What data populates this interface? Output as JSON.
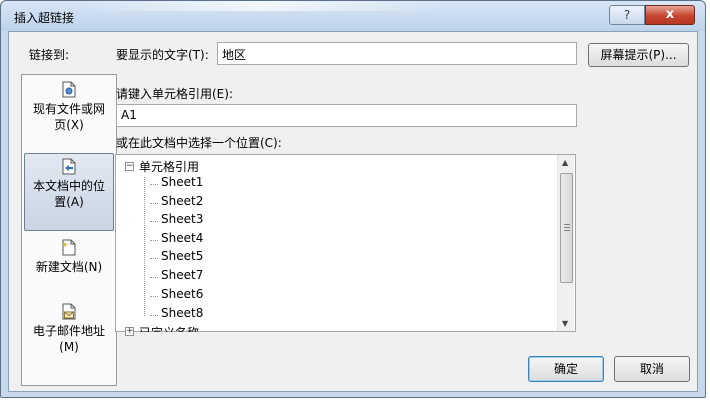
{
  "window": {
    "title": "插入超链接",
    "help_glyph": "?",
    "close_glyph": "x"
  },
  "link_to": {
    "label": "链接到:",
    "items": [
      {
        "line1": "现有文件或网",
        "line2": "页(X)",
        "icon": "existing-file-icon",
        "selected": false
      },
      {
        "line1": "本文档中的位",
        "line2": "置(A)",
        "icon": "document-place-icon",
        "selected": true
      },
      {
        "line1": "新建文档(N)",
        "line2": "",
        "icon": "new-document-icon",
        "selected": false
      },
      {
        "line1": "电子邮件地址",
        "line2": "(M)",
        "icon": "email-address-icon",
        "selected": false
      }
    ]
  },
  "display_text": {
    "label": "要显示的文字(T):",
    "value": "地区"
  },
  "screen_tip_button": "屏幕提示(P)...",
  "cell_reference": {
    "label": "请键入单元格引用(E):",
    "value": "A1"
  },
  "place": {
    "label": "或在此文档中选择一个位置(C):",
    "root": "单元格引用",
    "sheets": [
      "Sheet1",
      "Sheet2",
      "Sheet3",
      "Sheet4",
      "Sheet5",
      "Sheet7",
      "Sheet6",
      "Sheet8"
    ],
    "selected_sheet": "Sheet1",
    "defined_names": "已定义名称"
  },
  "buttons": {
    "ok": "确定",
    "cancel": "取消"
  }
}
